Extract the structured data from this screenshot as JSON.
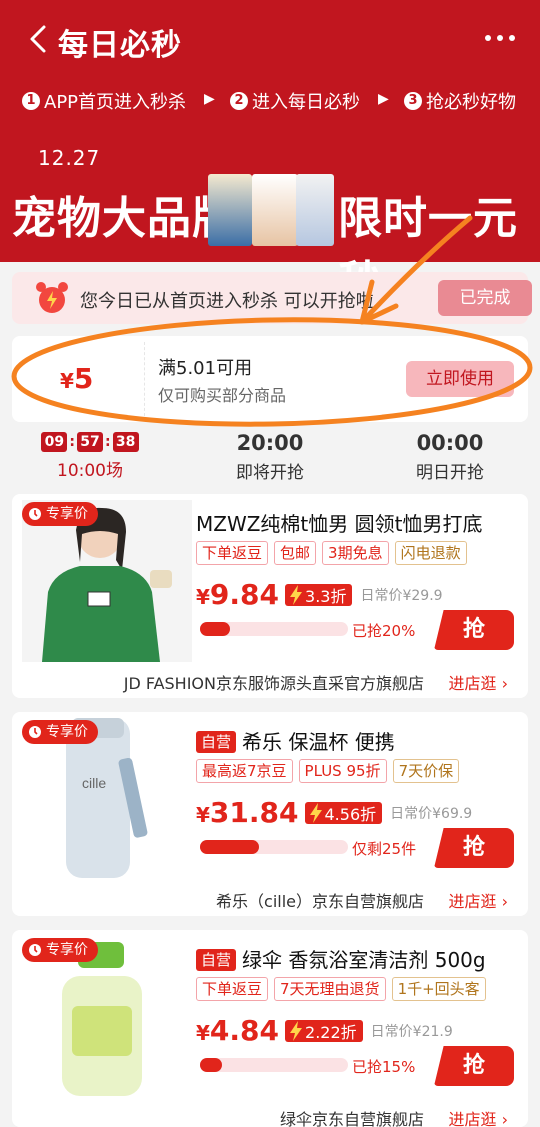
{
  "header": {
    "title": "每日必秒",
    "steps": [
      {
        "num": "1",
        "text": "APP首页进入秒杀"
      },
      {
        "num": "2",
        "text": "进入每日必秒"
      },
      {
        "num": "3",
        "text": "抢必秒好物"
      }
    ],
    "date": "12.27",
    "banner_left": "宠物大品牌",
    "banner_right": "限时一元秒"
  },
  "notice": {
    "text": "您今日已从首页进入秒杀 可以开抢啦",
    "button": "已完成"
  },
  "coupon": {
    "symbol": "¥",
    "amount": "5",
    "condition": "满5.01可用",
    "scope": "仅可购买部分商品",
    "button": "立即使用"
  },
  "sessions": [
    {
      "countdown": [
        "09",
        "57",
        "38"
      ],
      "label": "10:00场",
      "active": true
    },
    {
      "time": "20:00",
      "label": "即将开抢"
    },
    {
      "time": "00:00",
      "label": "明日开抢"
    }
  ],
  "products": [
    {
      "badge": "专享价",
      "self_run": false,
      "title": "MZWZ纯棉t恤男 圆领t恤男打底",
      "tags": [
        "下单返豆",
        "包邮",
        "3期免息",
        "闪电退款"
      ],
      "price_symbol": "¥",
      "price": "9.84",
      "discount": "3.3折",
      "original": "日常价¥29.9",
      "progress": 0.2,
      "progress_text": "已抢20%",
      "grab": "抢",
      "store": "JD FASHION京东服饰源头直采官方旗舰店",
      "store_link": "进店逛 ›"
    },
    {
      "badge": "专享价",
      "self_run": true,
      "self_label": "自营",
      "title": "希乐 保温杯 便携",
      "tags": [
        "最高返7京豆",
        "PLUS 95折",
        "7天价保"
      ],
      "price_symbol": "¥",
      "price": "31.84",
      "discount": "4.56折",
      "original": "日常价¥69.9",
      "progress": 0.4,
      "progress_text": "仅剩25件",
      "grab": "抢",
      "store": "希乐（cille）京东自营旗舰店",
      "store_link": "进店逛 ›"
    },
    {
      "badge": "专享价",
      "self_run": true,
      "self_label": "自营",
      "title": "绿伞 香氛浴室清洁剂 500g",
      "tags": [
        "下单返豆",
        "7天无理由退货",
        "1千+回头客"
      ],
      "price_symbol": "¥",
      "price": "4.84",
      "discount": "2.22折",
      "original": "日常价¥21.9",
      "progress": 0.15,
      "progress_text": "已抢15%",
      "grab": "抢",
      "store": "绿伞京东自营旗舰店",
      "store_link": "进店逛 ›"
    }
  ],
  "colors": {
    "brand": "#c1161f",
    "accent": "#e1251b"
  }
}
